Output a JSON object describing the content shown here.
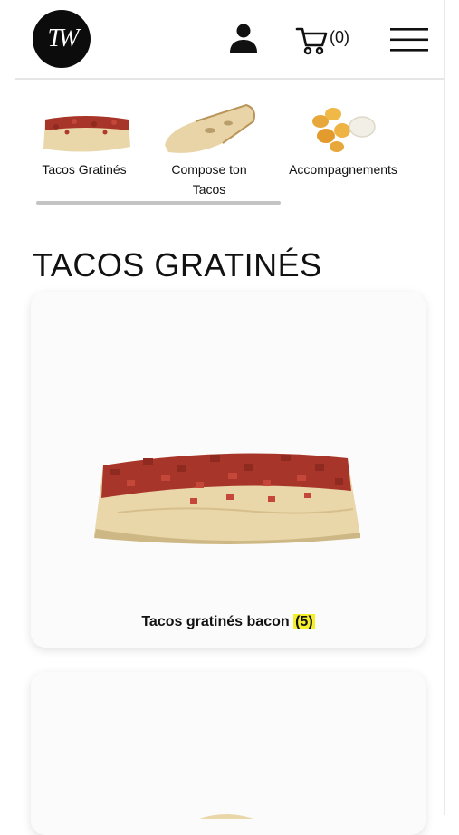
{
  "header": {
    "logo_text": "TW",
    "cart_count": "(0)"
  },
  "categories": [
    {
      "label": "Tacos Gratinés",
      "thumb": "tacos-gratines"
    },
    {
      "label": "Compose ton Tacos",
      "thumb": "compose-tacos"
    },
    {
      "label": "Accompagnements",
      "thumb": "accompagnements"
    }
  ],
  "section": {
    "title": "TACOS GRATINÉS"
  },
  "products": [
    {
      "name": "Tacos gratinés bacon",
      "badge": "(5)"
    }
  ],
  "colors": {
    "badge_bg": "#f5ee2b",
    "bacon": "#a8352a",
    "tortilla": "#e9d7aa"
  }
}
